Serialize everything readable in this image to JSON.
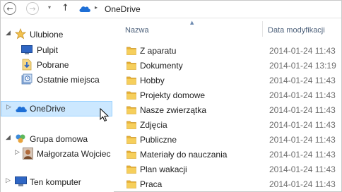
{
  "address": {
    "back": "←",
    "forward": "→",
    "recent": "▾",
    "up": "↑",
    "separator": "▸",
    "path": "OneDrive",
    "cloud_icon": "onedrive-cloud-icon"
  },
  "sidebar": {
    "favorites": {
      "label": "Ulubione",
      "icon": "star-icon",
      "items": [
        {
          "label": "Pulpit",
          "icon": "desktop-icon"
        },
        {
          "label": "Pobrane",
          "icon": "downloads-icon"
        },
        {
          "label": "Ostatnie miejsca",
          "icon": "recent-places-icon"
        }
      ]
    },
    "onedrive": {
      "label": "OneDrive",
      "icon": "onedrive-cloud-icon",
      "selected": true
    },
    "homegroup": {
      "label": "Grupa domowa",
      "icon": "homegroup-icon",
      "items": [
        {
          "label": "Małgorzata Wojciec",
          "icon": "user-avatar-icon"
        }
      ]
    },
    "computer": {
      "label": "Ten komputer",
      "icon": "computer-icon"
    },
    "caret": "▷"
  },
  "columns": {
    "name": "Nazwa",
    "date": "Data modyfikacji",
    "sort_indicator": "▲"
  },
  "files": [
    {
      "name": "Z aparatu",
      "date": "2014-01-24 11:43"
    },
    {
      "name": "Dokumenty",
      "date": "2014-01-24 13:19"
    },
    {
      "name": "Hobby",
      "date": "2014-01-24 11:43"
    },
    {
      "name": "Projekty domowe",
      "date": "2014-01-24 11:43"
    },
    {
      "name": "Nasze zwierzątka",
      "date": "2014-01-24 11:43"
    },
    {
      "name": "Zdjęcia",
      "date": "2014-01-24 11:43"
    },
    {
      "name": "Publiczne",
      "date": "2014-01-24 11:43"
    },
    {
      "name": "Materiały do nauczania",
      "date": "2014-01-24 11:43"
    },
    {
      "name": "Plan wakacji",
      "date": "2014-01-24 11:43"
    },
    {
      "name": "Praca",
      "date": "2014-01-24 11:43"
    }
  ],
  "colors": {
    "selection_bg": "#cce8ff",
    "selection_border": "#99d1ff",
    "header_text": "#4c607a",
    "folder": "#f3c54b",
    "cloud": "#1e6fd6"
  }
}
